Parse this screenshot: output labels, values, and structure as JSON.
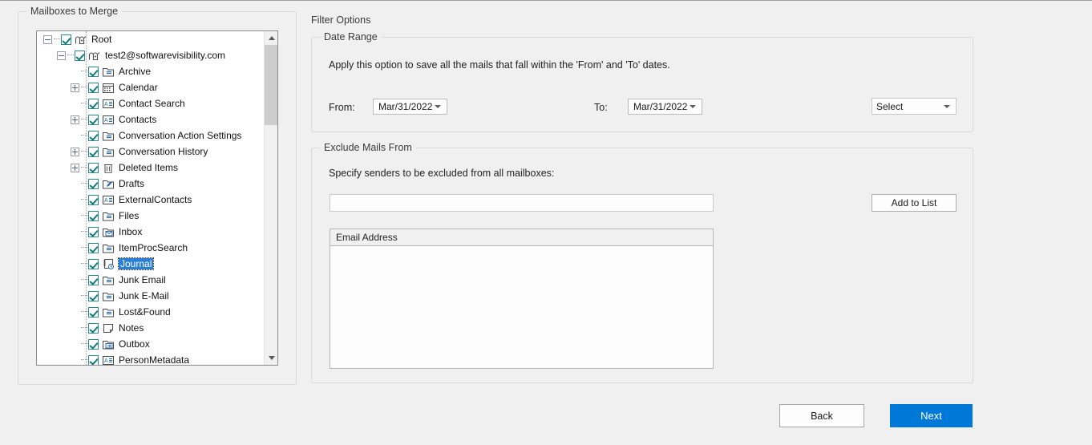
{
  "left_panel": {
    "title": "Mailboxes to Merge",
    "tree": [
      {
        "label": "Root",
        "depth": 0,
        "icon": "mailbox-root-icon",
        "expander": "minus",
        "checked": true,
        "selected": false
      },
      {
        "label": "test2@softwarevisibility.com",
        "depth": 1,
        "icon": "mailbox-icon",
        "expander": "minus",
        "checked": true,
        "selected": false
      },
      {
        "label": "Archive",
        "depth": 2,
        "icon": "folder-note-icon",
        "expander": "none",
        "checked": true,
        "selected": false
      },
      {
        "label": "Calendar",
        "depth": 2,
        "icon": "calendar-icon",
        "expander": "plus",
        "checked": true,
        "selected": false
      },
      {
        "label": "Contact Search",
        "depth": 2,
        "icon": "contacts-icon",
        "expander": "none",
        "checked": true,
        "selected": false
      },
      {
        "label": "Contacts",
        "depth": 2,
        "icon": "contacts-icon",
        "expander": "plus",
        "checked": true,
        "selected": false
      },
      {
        "label": "Conversation Action Settings",
        "depth": 2,
        "icon": "folder-note-icon",
        "expander": "none",
        "checked": true,
        "selected": false
      },
      {
        "label": "Conversation History",
        "depth": 2,
        "icon": "folder-note-icon",
        "expander": "plus",
        "checked": true,
        "selected": false
      },
      {
        "label": "Deleted Items",
        "depth": 2,
        "icon": "trash-icon",
        "expander": "plus",
        "checked": true,
        "selected": false
      },
      {
        "label": "Drafts",
        "depth": 2,
        "icon": "drafts-pencil-icon",
        "expander": "none",
        "checked": true,
        "selected": false
      },
      {
        "label": "ExternalContacts",
        "depth": 2,
        "icon": "contacts-icon",
        "expander": "none",
        "checked": true,
        "selected": false
      },
      {
        "label": "Files",
        "depth": 2,
        "icon": "folder-note-icon",
        "expander": "none",
        "checked": true,
        "selected": false
      },
      {
        "label": "Inbox",
        "depth": 2,
        "icon": "inbox-icon",
        "expander": "none",
        "checked": true,
        "selected": false
      },
      {
        "label": "ItemProcSearch",
        "depth": 2,
        "icon": "folder-note-icon",
        "expander": "none",
        "checked": true,
        "selected": false
      },
      {
        "label": "Journal",
        "depth": 2,
        "icon": "journal-clock-icon",
        "expander": "none",
        "checked": true,
        "selected": true
      },
      {
        "label": "Junk Email",
        "depth": 2,
        "icon": "folder-note-icon",
        "expander": "none",
        "checked": true,
        "selected": false
      },
      {
        "label": "Junk E-Mail",
        "depth": 2,
        "icon": "folder-note-icon",
        "expander": "none",
        "checked": true,
        "selected": false
      },
      {
        "label": "Lost&Found",
        "depth": 2,
        "icon": "folder-note-icon",
        "expander": "none",
        "checked": true,
        "selected": false
      },
      {
        "label": "Notes",
        "depth": 2,
        "icon": "note-icon",
        "expander": "none",
        "checked": true,
        "selected": false
      },
      {
        "label": "Outbox",
        "depth": 2,
        "icon": "outbox-icon",
        "expander": "none",
        "checked": true,
        "selected": false
      },
      {
        "label": "PersonMetadata",
        "depth": 2,
        "icon": "contacts-icon",
        "expander": "none",
        "checked": true,
        "selected": false
      }
    ],
    "scrollbar": {
      "up_arrow": "scroll-up-icon",
      "down_arrow": "scroll-down-icon"
    }
  },
  "filter_options": {
    "title": "Filter Options",
    "date_range": {
      "title": "Date Range",
      "description": "Apply this option to save all the mails that fall within the 'From' and 'To' dates.",
      "from_label": "From:",
      "from_value": "Mar/31/2022",
      "to_label": "To:",
      "to_value": "Mar/31/2022",
      "select_value": "Select"
    },
    "exclude": {
      "title": "Exclude Mails From",
      "description": "Specify senders to be excluded from all mailboxes:",
      "input_value": "",
      "input_placeholder": "",
      "add_button_label": "Add to List",
      "list_columns": [
        "Email Address"
      ],
      "list_rows": []
    }
  },
  "footer": {
    "back_label": "Back",
    "next_label": "Next"
  },
  "colors": {
    "accent_blue": "#0078d7",
    "selection_blue": "#2a7fd4",
    "checkbox_teal": "#0f7b7b",
    "window_bg": "#f0f0f0"
  }
}
